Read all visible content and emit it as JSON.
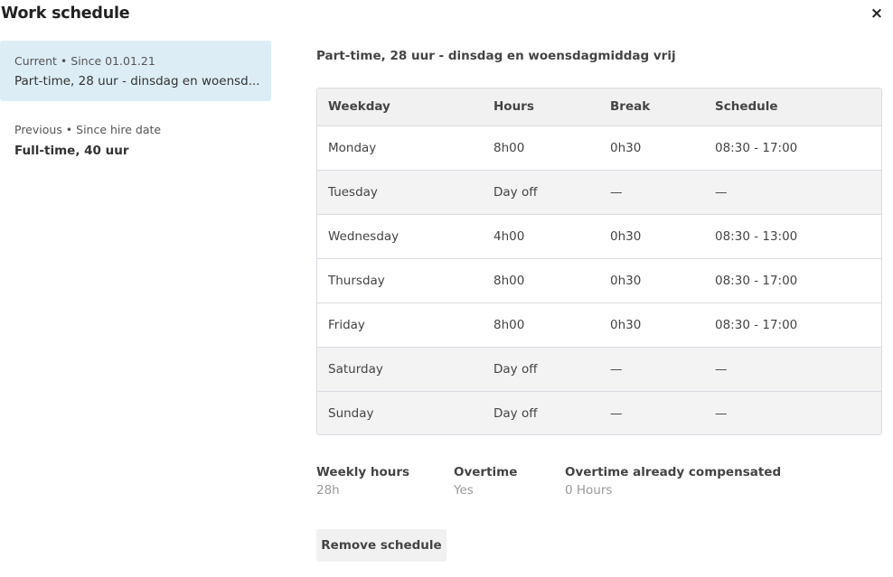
{
  "dialog": {
    "title": "Work schedule",
    "close_label": "×"
  },
  "schedules": [
    {
      "meta": "Current • Since 01.01.21",
      "name": "Part-time, 28 uur - dinsdag en woensd..."
    },
    {
      "meta": "Previous • Since hire date",
      "name": "Full-time, 40 uur"
    }
  ],
  "detail": {
    "heading": "Part-time, 28 uur - dinsdag en woensdagmiddag vrij",
    "columns": [
      "Weekday",
      "Hours",
      "Break",
      "Schedule"
    ],
    "rows": [
      [
        "Monday",
        "8h00",
        "0h30",
        "08:30 - 17:00"
      ],
      [
        "Tuesday",
        "Day off",
        "—",
        "—"
      ],
      [
        "Wednesday",
        "4h00",
        "0h30",
        "08:30 - 13:00"
      ],
      [
        "Thursday",
        "8h00",
        "0h30",
        "08:30 - 17:00"
      ],
      [
        "Friday",
        "8h00",
        "0h30",
        "08:30 - 17:00"
      ],
      [
        "Saturday",
        "Day off",
        "—",
        "—"
      ],
      [
        "Sunday",
        "Day off",
        "—",
        "—"
      ]
    ]
  },
  "summary": {
    "weekly_hours": {
      "label": "Weekly hours",
      "value": "28h"
    },
    "overtime": {
      "label": "Overtime",
      "value": "Yes"
    },
    "overtime_compensated": {
      "label": "Overtime already compensated",
      "value": "0 Hours"
    }
  },
  "actions": {
    "remove_label": "Remove schedule"
  }
}
